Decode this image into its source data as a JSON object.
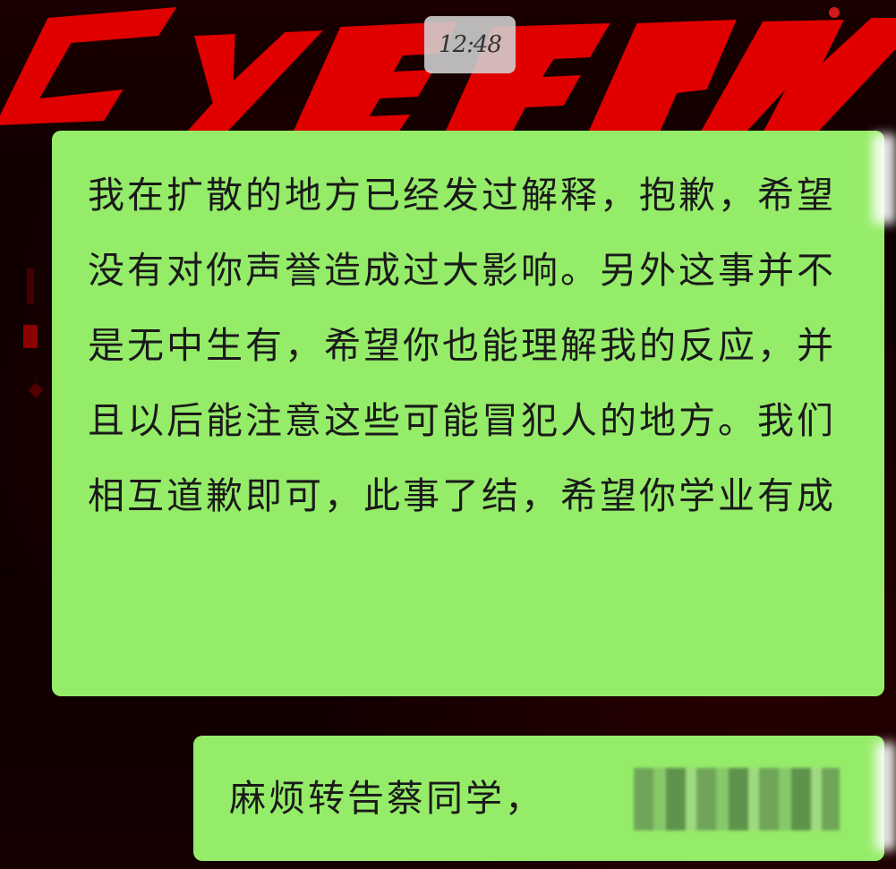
{
  "header": {
    "timestamp": "12:48"
  },
  "wallpaper": {
    "logo_text": "Cyberpunk",
    "accent_color": "#e00000"
  },
  "messages": [
    {
      "side": "outgoing",
      "bubble_color": "#95ec69",
      "text": "我在扩散的地方已经发过解释，抱歉，希望没有对你声誉造成过大影响。另外这事并不是无中生有，希望你也能理解我的反应，并且以后能注意这些可能冒犯人的地方。我们相互道歉即可，此事了结，希望你学业有成"
    },
    {
      "side": "outgoing",
      "bubble_color": "#95ec69",
      "text": "麻烦转告蔡同学，"
    }
  ]
}
